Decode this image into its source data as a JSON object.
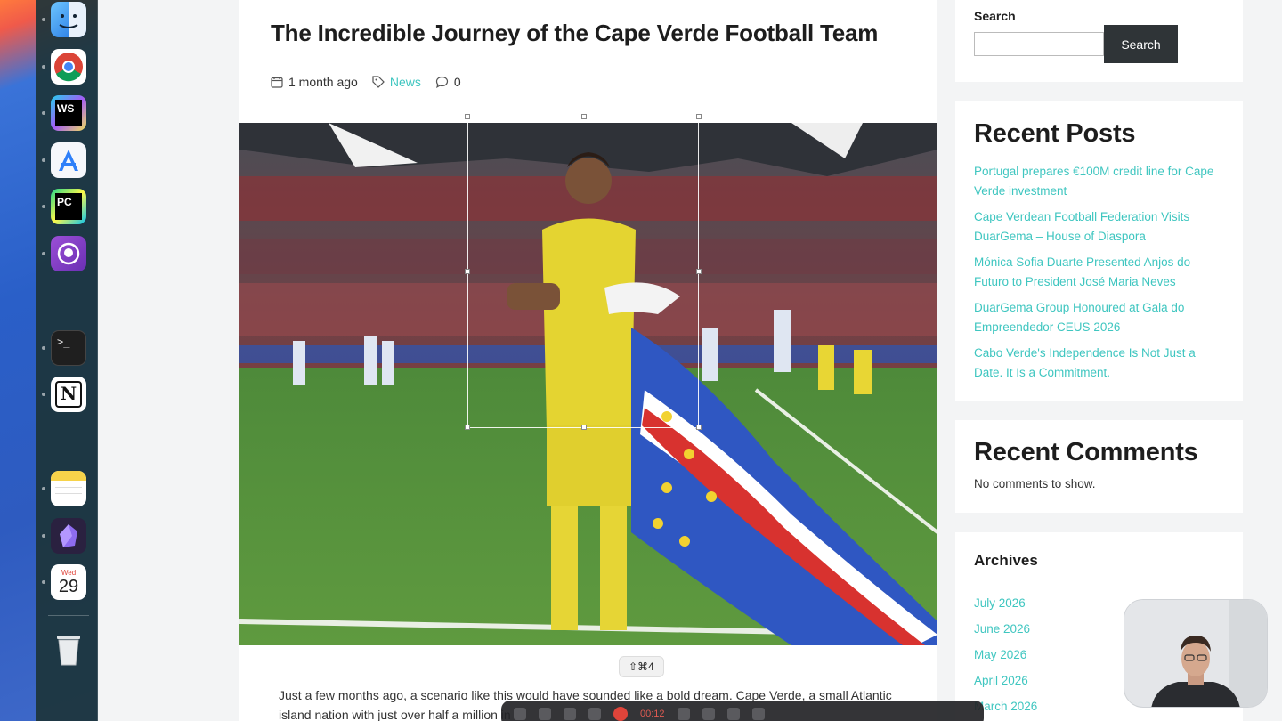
{
  "article": {
    "title": "The Incredible Journey of the Cape Verde Football Team",
    "date": "1 month ago",
    "category": "News",
    "comment_count": "0",
    "body": "Just a few months ago, a scenario like this would have sounded like a bold dream. Cape Verde, a small Atlantic island nation with just over half a million in"
  },
  "shortcut_hint": "⇧⌘4",
  "sidebar": {
    "search": {
      "label": "Search",
      "button": "Search",
      "value": ""
    },
    "recent_posts": {
      "heading": "Recent Posts",
      "items": [
        "Portugal prepares €100M credit line for Cape Verde investment",
        "Cape Verdean Football Federation Visits DuarGema – House of Diaspora",
        "Mónica Sofia Duarte Presented Anjos do Futuro to President José Maria Neves",
        "DuarGema Group Honoured at Gala do Empreendedor CEUS 2026",
        "Cabo Verde's Independence Is Not Just a Date. It Is a Commitment."
      ]
    },
    "recent_comments": {
      "heading": "Recent Comments",
      "empty": "No comments to show."
    },
    "archives": {
      "heading": "Archives",
      "items": [
        "July 2026",
        "June 2026",
        "May 2026",
        "April 2026",
        "March 2026"
      ]
    }
  },
  "dock": {
    "items": [
      "finder-icon",
      "chrome-icon",
      "webstorm-icon",
      "xcode-instruments-icon",
      "pycharm-icon",
      "github-desktop-icon",
      "terminal-icon",
      "notion-icon",
      "notes-icon",
      "obsidian-icon",
      "calendar-icon",
      "trash-icon"
    ],
    "calendar_day_label": "Wed",
    "calendar_day": "29"
  },
  "recording": {
    "time": "00:12"
  },
  "colors": {
    "accent": "#3fc6c0",
    "search_button": "#2f3437",
    "dock_bg": "#1c343a"
  }
}
